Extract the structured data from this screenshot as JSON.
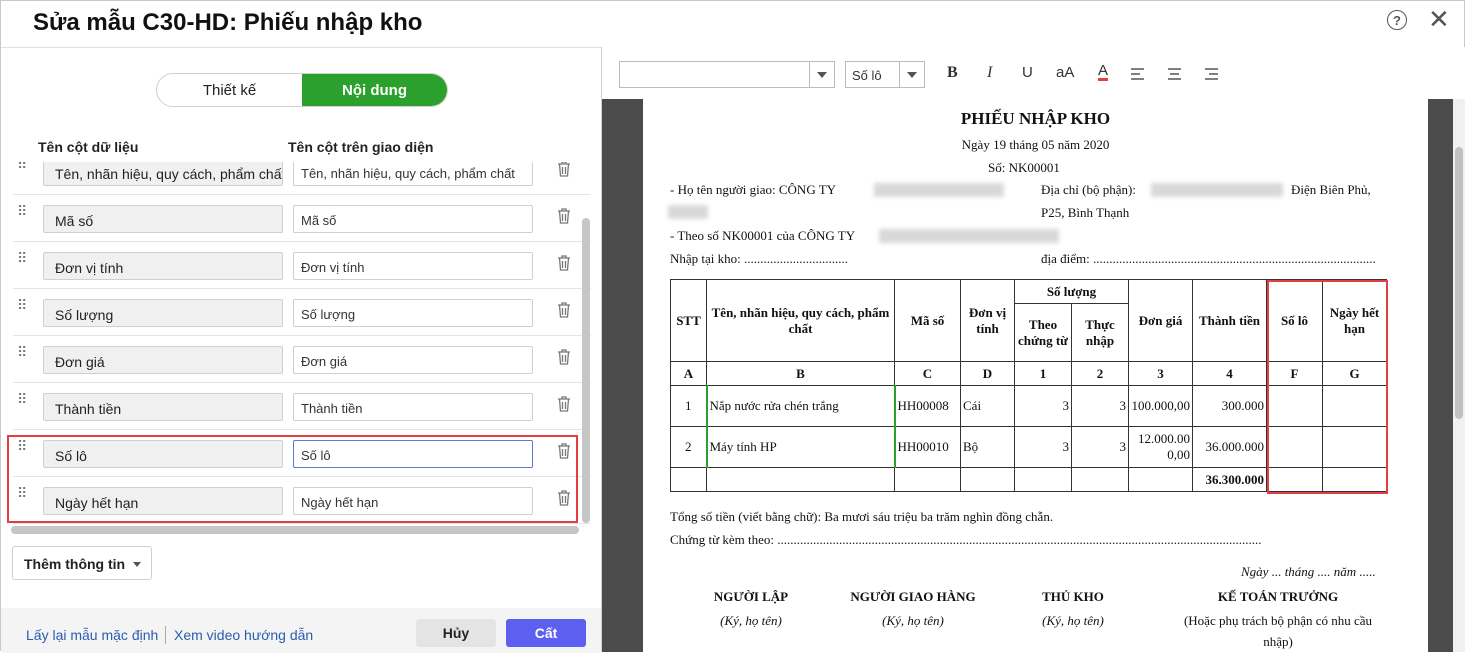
{
  "dialog": {
    "title": "Sửa mẫu C30-HD: Phiếu nhập kho",
    "help": "?",
    "close": "✕"
  },
  "tabs": [
    {
      "label": "Thiết kế"
    },
    {
      "label": "Nội dung"
    }
  ],
  "columns": {
    "data_header": "Tên cột dữ liệu",
    "ui_header": "Tên cột trên giao diện"
  },
  "rows": [
    {
      "data": "Tên, nhãn hiệu, quy cách, phẩm chất",
      "ui": "Tên, nhãn hiệu, quy cách, phẩm chất"
    },
    {
      "data": "Mã số",
      "ui": "Mã số"
    },
    {
      "data": "Đơn vị tính",
      "ui": "Đơn vị tính"
    },
    {
      "data": "Số lượng",
      "ui": "Số lượng"
    },
    {
      "data": "Đơn giá",
      "ui": "Đơn giá"
    },
    {
      "data": "Thành tiền",
      "ui": "Thành tiền"
    },
    {
      "data": "Số lô",
      "ui": "Số lô"
    },
    {
      "data": "Ngày hết hạn",
      "ui": "Ngày hết hạn"
    }
  ],
  "add_info": "Thêm thông tin",
  "footer": {
    "reset": "Lấy lại mẫu mặc định",
    "video": "Xem video hướng dẫn",
    "cancel": "Hủy",
    "save": "Cất"
  },
  "toolbar": {
    "font": "",
    "size": "Số lô",
    "bold": "B",
    "italic": "I",
    "underline": "U",
    "case": "aA",
    "color": "A",
    "accent_color": "#e53e3e"
  },
  "doc": {
    "title": "PHIẾU NHẬP KHO",
    "date": "Ngày 19 tháng 05 năm 2020",
    "number": "Số:  NK00001",
    "deliverer": "- Họ tên người giao: CÔNG TY",
    "address_label": "Địa chỉ (bộ phận):",
    "address_tail": "Điện Biên Phủ,",
    "address_line2": "P25, Bình Thạnh",
    "ref": "- Theo số NK00001  của CÔNG TY",
    "warehouse": "Nhập tại kho:  ................................",
    "location": "địa điểm:  .......................................................................................",
    "headers": {
      "stt": "STT",
      "name": "Tên, nhãn hiệu, quy cách, phẩm chất",
      "code": "Mã số",
      "unit": "Đơn vị tính",
      "qty": "Số lượng",
      "qty_doc": "Theo chứng từ",
      "qty_real": "Thực nhập",
      "price": "Đơn giá",
      "amount": "Thành tiền",
      "lot": "Số lô",
      "expiry": "Ngày hết hạn"
    },
    "letters": [
      "A",
      "B",
      "C",
      "D",
      "1",
      "2",
      "3",
      "4",
      "F",
      "G"
    ],
    "items": [
      {
        "stt": "1",
        "name": "Nắp nước rửa chén trắng",
        "code": "HH00008",
        "unit": "Cái",
        "qty_doc": "3",
        "qty_real": "3",
        "price": "100.000,00",
        "amount": "300.000"
      },
      {
        "stt": "2",
        "name": "Máy tính HP",
        "code": "HH00010",
        "unit": "Bộ",
        "qty_doc": "3",
        "qty_real": "3",
        "price": "12.000.000,00",
        "amount": "36.000.000"
      }
    ],
    "total": "36.300.000",
    "total_words": "Tổng số tiền (viết bằng chữ): Ba mươi sáu triệu ba trăm nghìn đồng chẵn.",
    "attached": "Chứng từ kèm theo:  .....................................................................................................................................................",
    "sign_date": "Ngày ... tháng .... năm .....",
    "signers": [
      {
        "role": "NGƯỜI LẬP",
        "note": "(Ký, họ tên)"
      },
      {
        "role": "NGƯỜI GIAO HÀNG",
        "note": "(Ký, họ tên)"
      },
      {
        "role": "THỦ KHO",
        "note": "(Ký, họ tên)"
      },
      {
        "role": "KẾ TOÁN TRƯỞNG",
        "note": "(Hoặc phụ trách bộ phận có nhu cầu",
        "note2": "nhập)"
      }
    ]
  }
}
